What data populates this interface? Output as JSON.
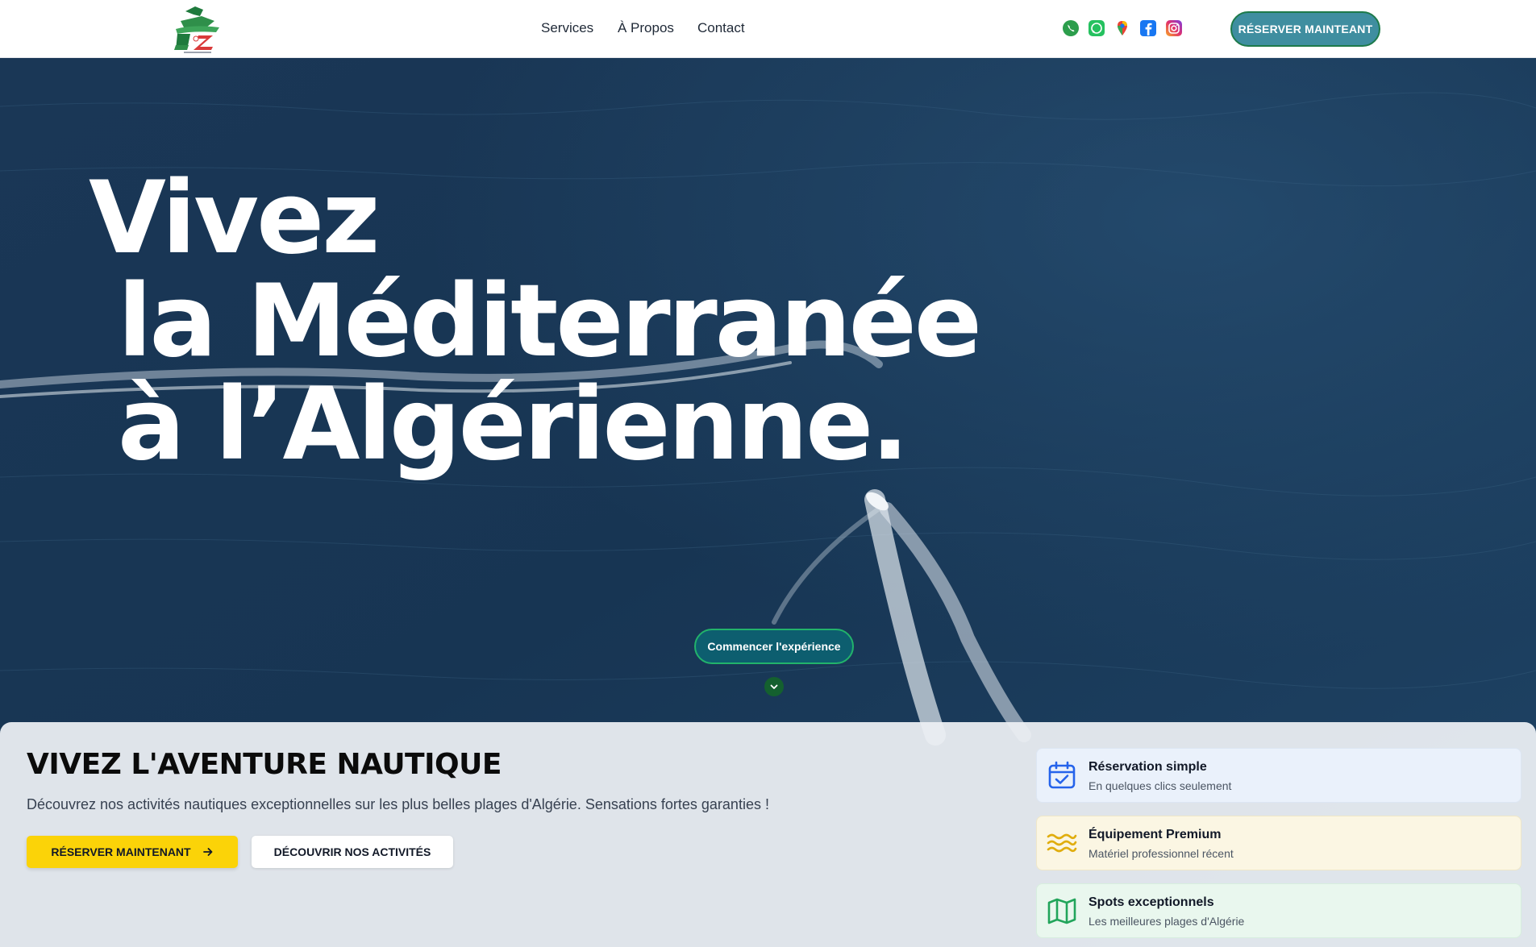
{
  "header": {
    "nav": [
      "Services",
      "À Propos",
      "Contact"
    ],
    "social": [
      "phone-icon",
      "whatsapp-icon",
      "map-pin-icon",
      "facebook-icon",
      "instagram-icon"
    ],
    "cta_label": "RÉSERVER MAINTEANT"
  },
  "hero": {
    "title_line1": "Vivez",
    "title_line2": "la Méditerranée",
    "title_line3": "à l’Algérienne.",
    "cta_label": "Commencer l'expérience"
  },
  "panel": {
    "title": "VIVEZ L'AVENTURE NAUTIQUE",
    "subtitle": "Découvrez nos activités nautiques exceptionnelles sur les plus belles plages d'Algérie. Sensations fortes garanties !",
    "primary_button": "RÉSERVER MAINTENANT",
    "secondary_button": "DÉCOUVRIR NOS ACTIVITÉS",
    "features": [
      {
        "title": "Réservation simple",
        "desc": "En quelques clics seulement",
        "icon": "calendar-check-icon"
      },
      {
        "title": "Équipement Premium",
        "desc": "Matériel professionnel récent",
        "icon": "waves-icon"
      },
      {
        "title": "Spots exceptionnels",
        "desc": "Les meilleures plages d'Algérie",
        "icon": "map-icon"
      }
    ]
  },
  "colors": {
    "brand_teal": "#3f8ea0",
    "brand_green": "#1d7a4a",
    "accent_yellow": "#fbd308",
    "sea_blue": "#15314f"
  }
}
